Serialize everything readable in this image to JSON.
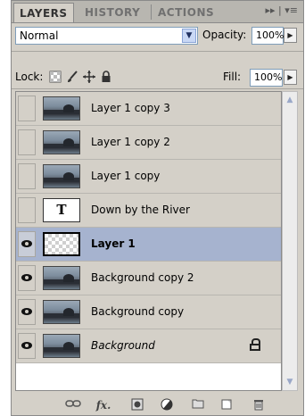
{
  "tabs": [
    {
      "label": "LAYERS",
      "active": true
    },
    {
      "label": "HISTORY",
      "active": false
    },
    {
      "label": "ACTIONS",
      "active": false
    }
  ],
  "tab_menu_glyph": "▸▸ | ▾≡",
  "blend_mode": {
    "value": "Normal"
  },
  "opacity": {
    "label": "Opacity:",
    "value": "100%"
  },
  "lock": {
    "label": "Lock:"
  },
  "fill": {
    "label": "Fill:",
    "value": "100%"
  },
  "layers": [
    {
      "name": "Layer 1 copy 3",
      "visible": false,
      "type": "image",
      "selected": false
    },
    {
      "name": "Layer 1 copy 2",
      "visible": false,
      "type": "image",
      "selected": false
    },
    {
      "name": "Layer 1 copy",
      "visible": false,
      "type": "image",
      "selected": false
    },
    {
      "name": "Down by the River",
      "visible": false,
      "type": "text",
      "selected": false
    },
    {
      "name": "Layer 1",
      "visible": true,
      "type": "transparent",
      "selected": true
    },
    {
      "name": "Background copy 2",
      "visible": true,
      "type": "image",
      "selected": false
    },
    {
      "name": "Background copy",
      "visible": true,
      "type": "image",
      "selected": false
    },
    {
      "name": "Background",
      "visible": true,
      "type": "image",
      "selected": false,
      "locked": true
    }
  ],
  "text_thumb_glyph": "T",
  "bottom_toolbar": {
    "icons": [
      "link-layers-icon",
      "fx-icon",
      "layer-mask-icon",
      "adjustment-layer-icon",
      "new-group-icon",
      "new-layer-icon",
      "delete-layer-icon"
    ],
    "fx_label": "fx."
  },
  "colors": {
    "panel": "#d4d0c8",
    "selected_row": "#a6b3cf",
    "tab_bar": "#b8b6b0"
  }
}
